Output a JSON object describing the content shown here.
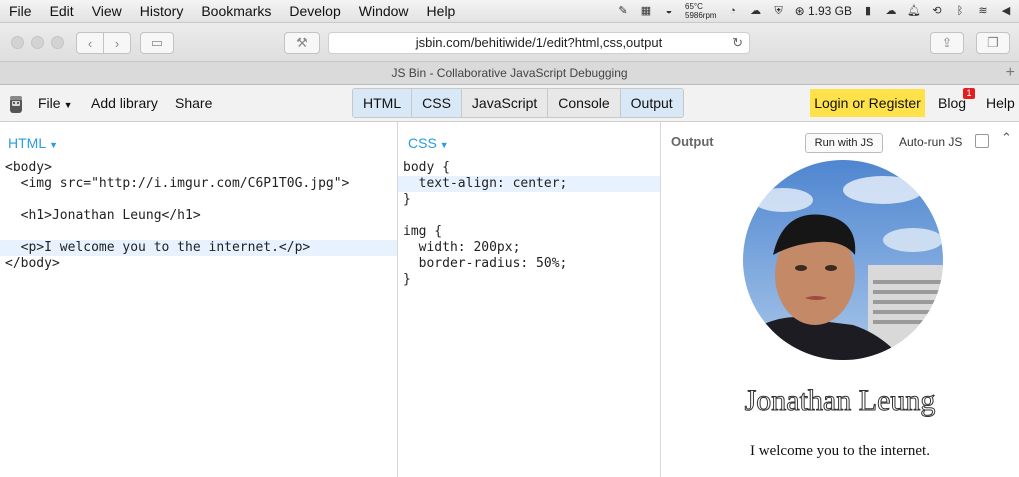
{
  "menubar": {
    "items": [
      "File",
      "Edit",
      "View",
      "History",
      "Bookmarks",
      "Develop",
      "Window",
      "Help"
    ],
    "status": {
      "temp": "65°C",
      "rpm": "5986rpm",
      "memory": "1.93 GB"
    }
  },
  "browser": {
    "url": "jsbin.com/behitiwide/1/edit?html,css,output",
    "tab_title": "JS Bin - Collaborative JavaScript Debugging"
  },
  "jsbin": {
    "file_label": "File",
    "add_library": "Add library",
    "share": "Share",
    "tabs": [
      "HTML",
      "CSS",
      "JavaScript",
      "Console",
      "Output"
    ],
    "login": "Login or Register",
    "blog": "Blog",
    "blog_badge": "1",
    "help": "Help"
  },
  "html_panel": {
    "label": "HTML",
    "lines": [
      "<body>",
      "  <img src=\"http://i.imgur.com/C6P1T0G.jpg\">",
      "",
      "  <h1>Jonathan Leung</h1>",
      "",
      "  <p>I welcome you to the internet.</p>",
      "</body>"
    ]
  },
  "css_panel": {
    "label": "CSS",
    "lines": [
      "body {",
      "  text-align: center;",
      "}",
      "",
      "img {",
      "  width: 200px;",
      "  border-radius: 50%;",
      "}"
    ]
  },
  "output_panel": {
    "label": "Output",
    "run_button": "Run with JS",
    "autorun_label": "Auto-run JS",
    "heading": "Jonathan Leung",
    "paragraph": "I welcome you to the internet."
  },
  "colors": {
    "accent": "#2a9ce0",
    "login_bg": "#ffe24a",
    "active_tab": "#d8e8f7"
  }
}
